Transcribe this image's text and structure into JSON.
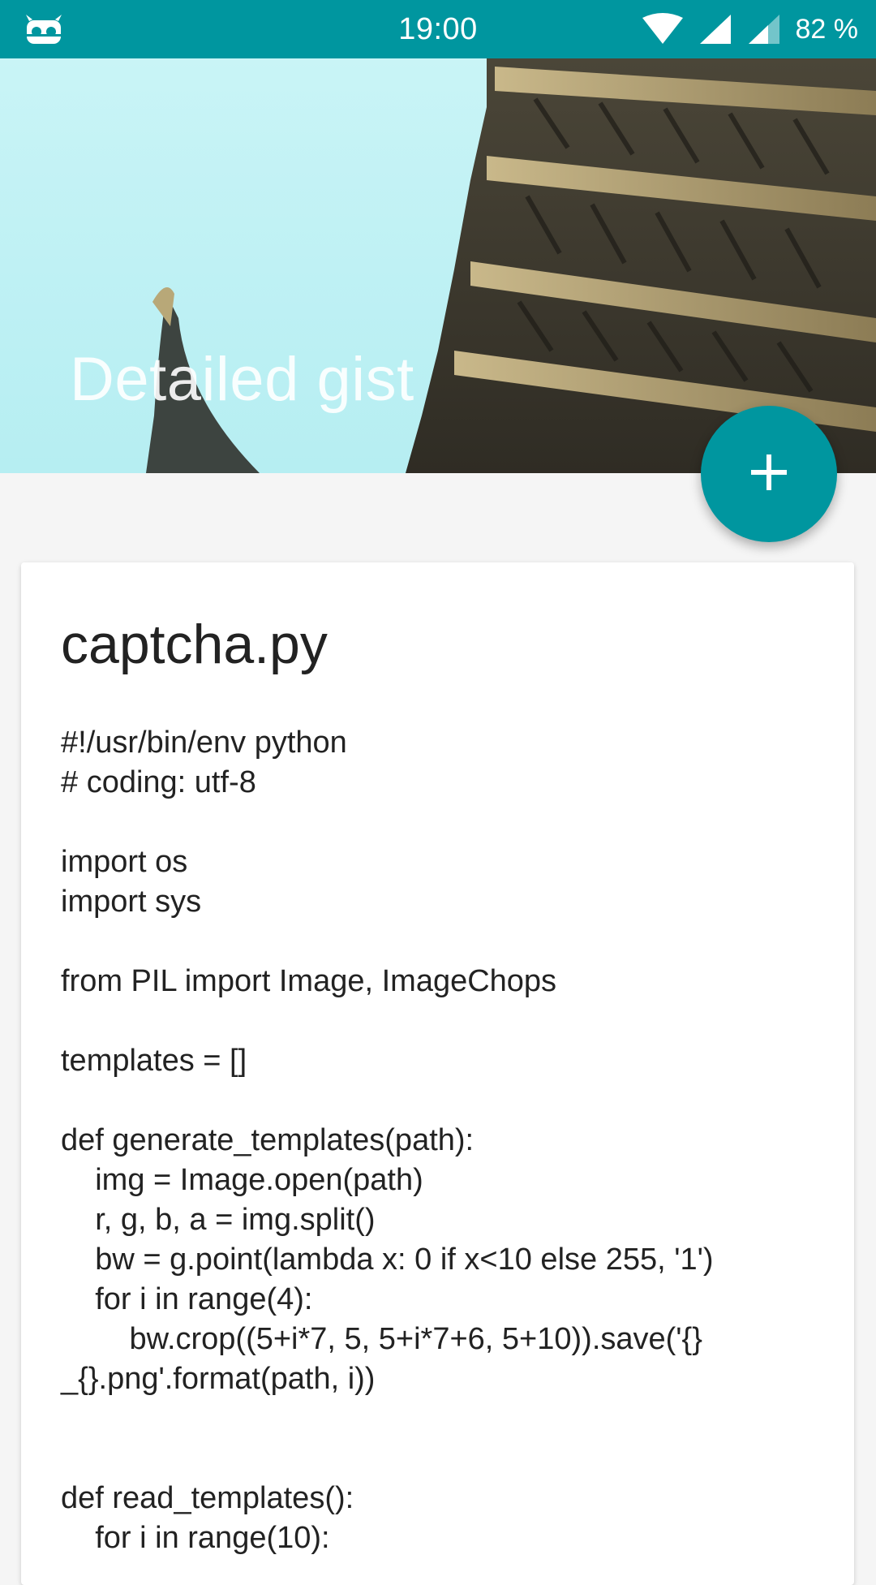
{
  "status_bar": {
    "time": "19:00",
    "battery": "82 %",
    "colors": {
      "background": "#00969f",
      "foreground": "#ffffff"
    },
    "icons": [
      "android-robot-icon",
      "wifi-icon",
      "signal-icon",
      "signal-secondary-icon"
    ]
  },
  "header": {
    "title": "Detailed gist",
    "image": "pagoda-roof-photo"
  },
  "fab": {
    "icon": "plus-icon",
    "color": "#00969f"
  },
  "gist": {
    "filename": "captcha.py",
    "code_lines": [
      "#!/usr/bin/env python",
      "# coding: utf-8",
      "",
      "import os",
      "import sys",
      "",
      "from PIL import Image, ImageChops",
      "",
      "templates = []",
      "",
      "def generate_templates(path):",
      "    img = Image.open(path)",
      "    r, g, b, a = img.split()",
      "    bw = g.point(lambda x: 0 if x<10 else 255, '1')",
      "    for i in range(4):",
      "        bw.crop((5+i*7, 5, 5+i*7+6, 5+10)).save('{}",
      "_{}.png'.format(path, i))",
      "",
      "",
      "def read_templates():",
      "    for i in range(10):"
    ]
  }
}
